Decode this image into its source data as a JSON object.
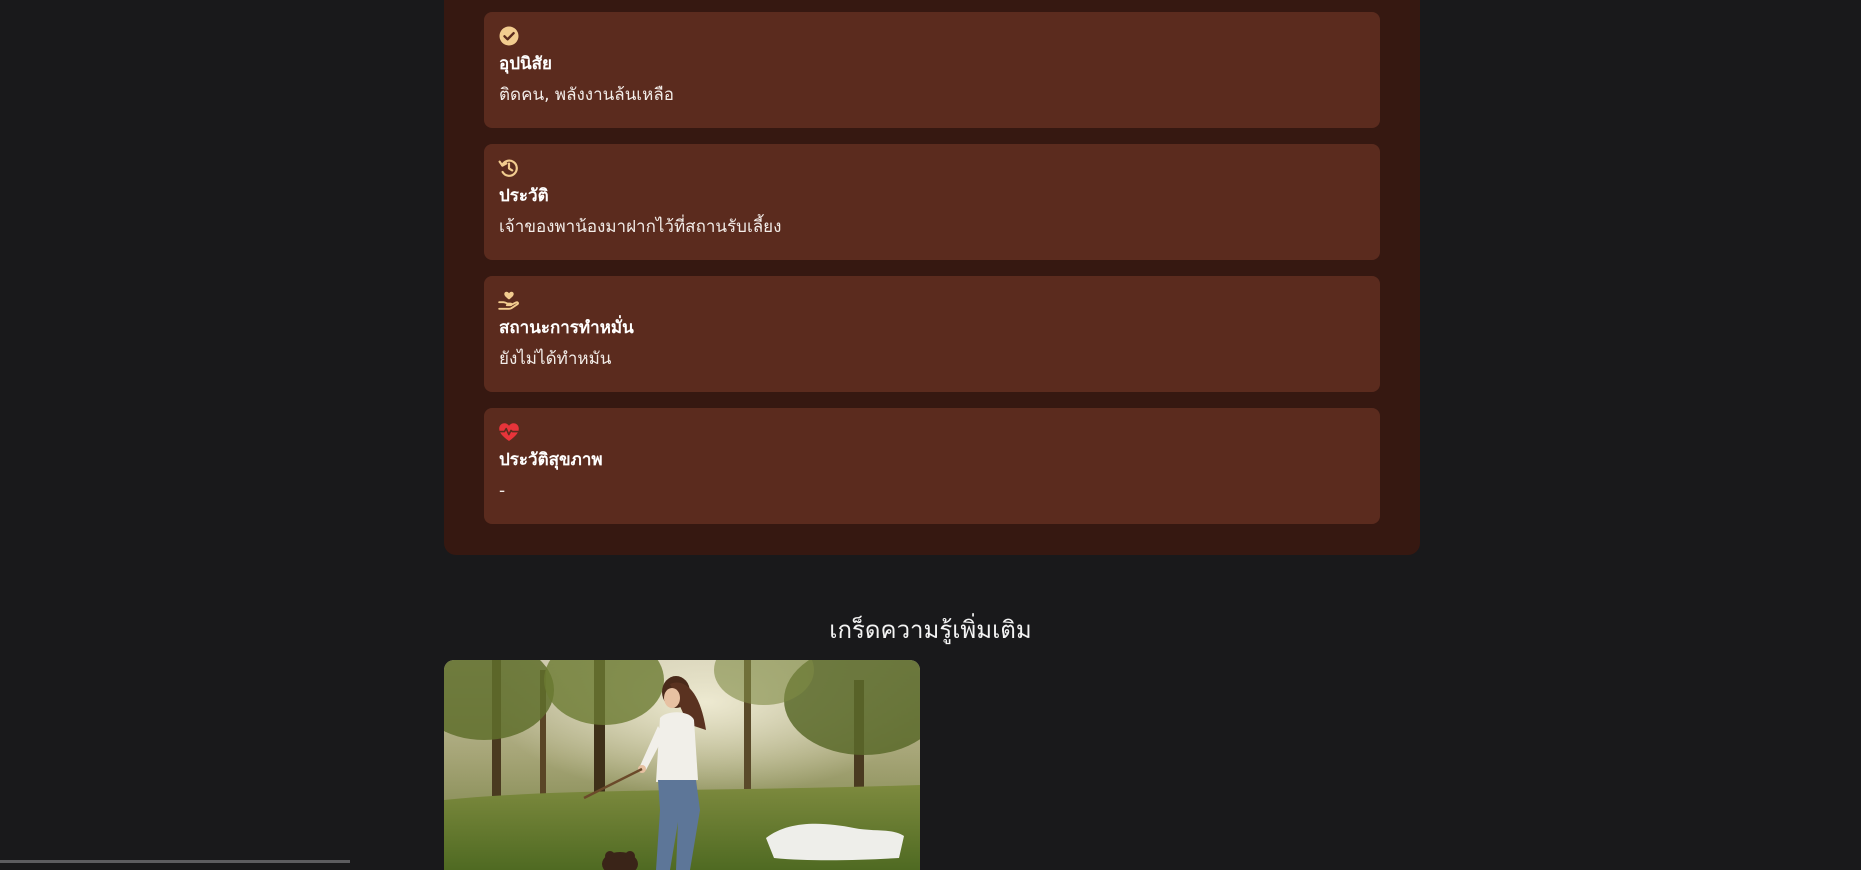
{
  "details": {
    "habit": {
      "icon": "check-circle-icon",
      "title": "อุปนิสัย",
      "value": "ติดคน, พลังงานล้นเหลือ"
    },
    "history": {
      "icon": "history-icon",
      "title": "ประวัติ",
      "value": "เจ้าของพาน้องมาฝากไว้ที่สถานรับเลี้ยง"
    },
    "neuter": {
      "icon": "hand-heart-icon",
      "title": "สถานะการทำหมั่น",
      "value": "ยังไม่ได้ทำหมัน"
    },
    "health": {
      "icon": "heart-pulse-icon",
      "title": "ประวัติสุขภาพ",
      "value": "-"
    }
  },
  "knowledge": {
    "title": "เกร็ดความรู้เพิ่มเติม"
  },
  "colors": {
    "page_background": "#19191b",
    "panel_background": "#361811",
    "card_background": "#5b2b1e",
    "icon_accent": "#f2cc8f",
    "health_icon": "#e8343a"
  }
}
